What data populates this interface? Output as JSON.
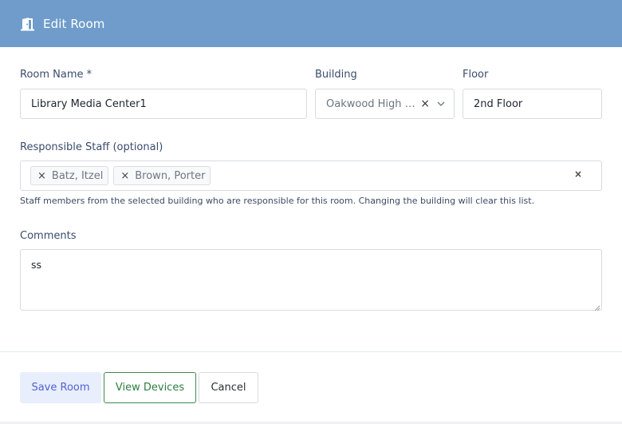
{
  "header": {
    "title": "Edit Room",
    "icon": "door-open-icon",
    "background": "#6f9ccb"
  },
  "form": {
    "room_name": {
      "label": "Room Name *",
      "value": "Library Media Center1"
    },
    "building": {
      "label": "Building",
      "value": "Oakwood High Sc...",
      "clear": "×"
    },
    "floor": {
      "label": "Floor",
      "value": "2nd Floor"
    },
    "responsible_staff": {
      "label": "Responsible Staff (optional)",
      "tags": [
        {
          "label": "Batz, Itzel",
          "remove": "×"
        },
        {
          "label": "Brown, Porter",
          "remove": "×"
        }
      ],
      "clear_all": "×",
      "help_text": "Staff members from the selected building who are responsible for this room. Changing the building will clear this list."
    },
    "comments": {
      "label": "Comments",
      "value": "ss"
    }
  },
  "actions": {
    "save_label": "Save Room",
    "view_devices_label": "View Devices",
    "cancel_label": "Cancel"
  }
}
